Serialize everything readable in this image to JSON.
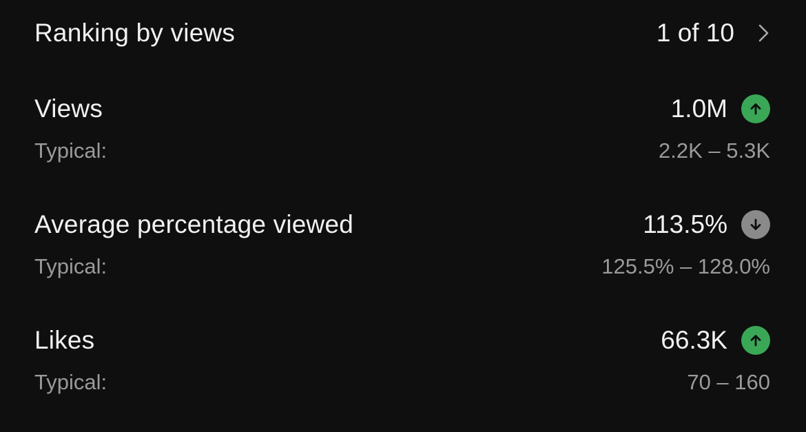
{
  "ranking": {
    "label": "Ranking by views",
    "value": "1 of 10",
    "icon": "chevron-right-icon"
  },
  "metrics": [
    {
      "label": "Views",
      "value": "1.0M",
      "trend": "up",
      "trend_icon": "arrow-up-icon",
      "trend_color": "#3aa757",
      "typical_label": "Typical:",
      "typical_range": "2.2K – 5.3K"
    },
    {
      "label": "Average percentage viewed",
      "value": "113.5%",
      "trend": "down",
      "trend_icon": "arrow-down-icon",
      "trend_color": "#8a8a8a",
      "typical_label": "Typical:",
      "typical_range": "125.5% – 128.0%"
    },
    {
      "label": "Likes",
      "value": "66.3K",
      "trend": "up",
      "trend_icon": "arrow-up-icon",
      "trend_color": "#3aa757",
      "typical_label": "Typical:",
      "typical_range": "70 – 160"
    }
  ]
}
